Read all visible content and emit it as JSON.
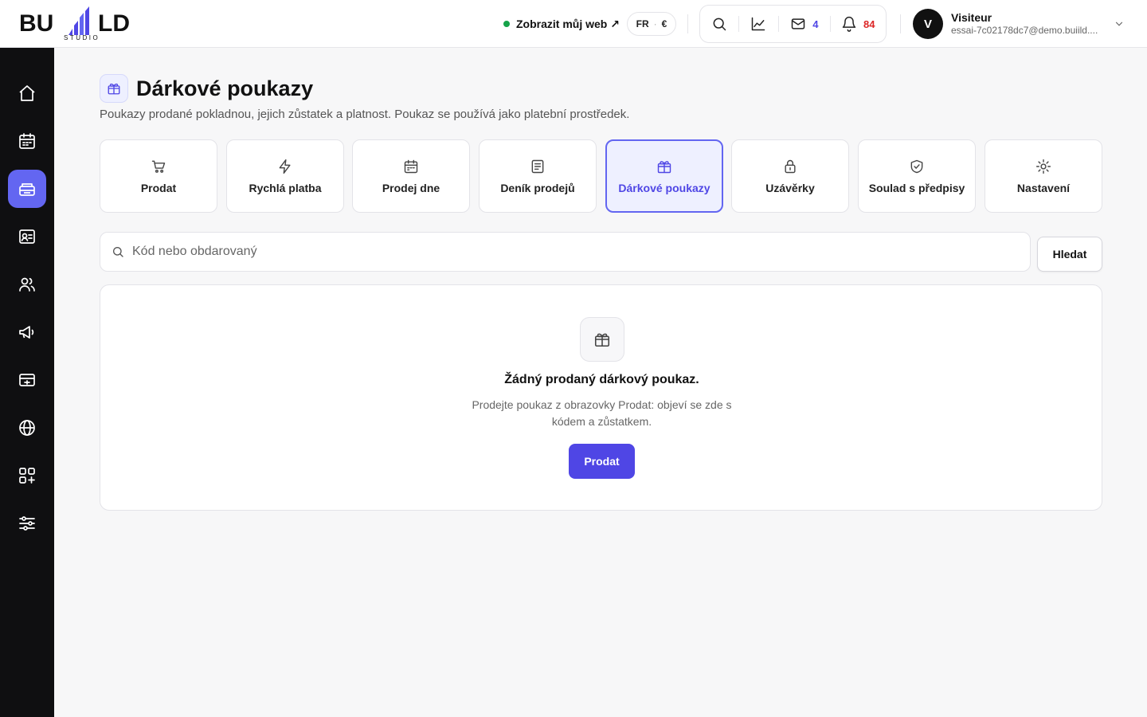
{
  "brand": {
    "logo_text_left": "BU",
    "logo_text_right": "LD",
    "logo_sub": "STUDIO"
  },
  "header": {
    "view_site_label": "Zobrazit můj web ↗",
    "lang": "FR",
    "lang_sep": "·",
    "currency": "€",
    "mail_count": "4",
    "notif_count": "84",
    "user": {
      "initial": "V",
      "name": "Visiteur",
      "email": "essai-7c02178dc7@demo.buiild...."
    }
  },
  "sidebar": {
    "items": [
      {
        "name": "home",
        "icon": "home-icon",
        "active": false
      },
      {
        "name": "calendar",
        "icon": "calendar-icon",
        "active": false
      },
      {
        "name": "cash-register",
        "icon": "register-icon",
        "active": true
      },
      {
        "name": "contacts",
        "icon": "id-card-icon",
        "active": false
      },
      {
        "name": "users",
        "icon": "users-icon",
        "active": false
      },
      {
        "name": "marketing",
        "icon": "megaphone-icon",
        "active": false
      },
      {
        "name": "payments",
        "icon": "card-icon",
        "active": false
      },
      {
        "name": "website",
        "icon": "globe-icon",
        "active": false
      },
      {
        "name": "apps",
        "icon": "apps-icon",
        "active": false
      },
      {
        "name": "settings",
        "icon": "sliders-icon",
        "active": false
      }
    ]
  },
  "page": {
    "title": "Dárkové poukazy",
    "subtitle": "Poukazy prodané pokladnou, jejich zůstatek a platnost. Poukaz se používá jako platební prostředek."
  },
  "tabs": [
    {
      "label": "Prodat",
      "icon": "cart-icon",
      "active": false
    },
    {
      "label": "Rychlá platba",
      "icon": "bolt-icon",
      "active": false
    },
    {
      "label": "Prodej dne",
      "icon": "calendar-icon",
      "active": false
    },
    {
      "label": "Deník prodejů",
      "icon": "journal-icon",
      "active": false
    },
    {
      "label": "Dárkové poukazy",
      "icon": "gift-icon",
      "active": true
    },
    {
      "label": "Uzávěrky",
      "icon": "lock-icon",
      "active": false
    },
    {
      "label": "Soulad s předpisy",
      "icon": "shield-check-icon",
      "active": false
    },
    {
      "label": "Nastavení",
      "icon": "sun-gear-icon",
      "active": false
    }
  ],
  "search": {
    "placeholder": "Kód nebo obdarovaný",
    "value": "",
    "button_label": "Hledat"
  },
  "empty_state": {
    "title": "Žádný prodaný dárkový poukaz.",
    "description": "Prodejte poukaz z obrazovky Prodat: objeví se zde s kódem a zůstatkem.",
    "button_label": "Prodat"
  },
  "colors": {
    "accent": "#4f46e5",
    "accent_light": "#eef0ff",
    "sidebar_bg": "#0f0f11",
    "online_dot": "#16a34a",
    "notif_red": "#dc2626"
  }
}
